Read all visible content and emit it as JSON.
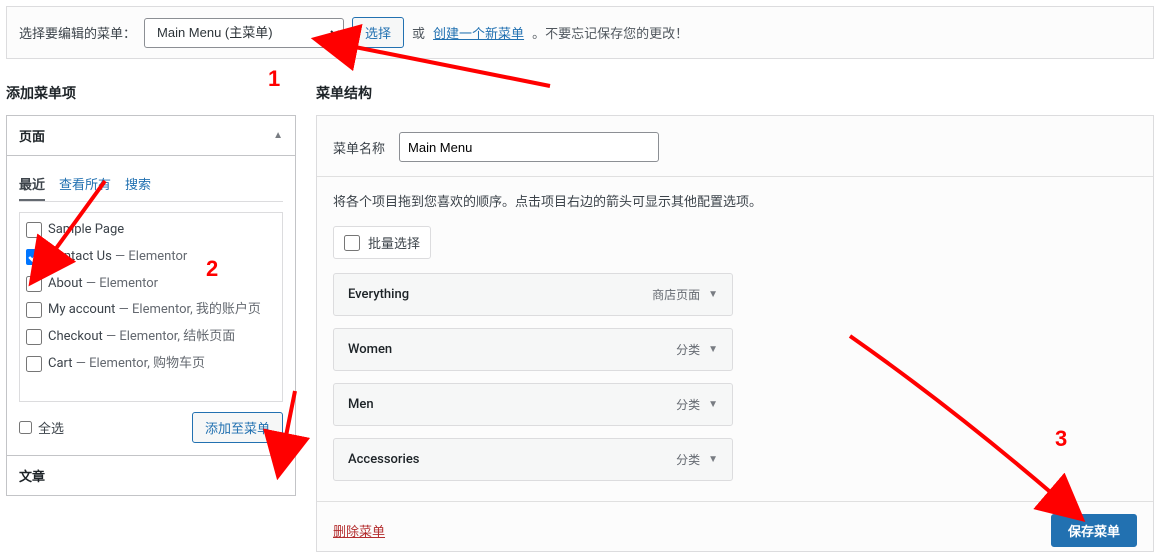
{
  "topbar": {
    "label": "选择要编辑的菜单：",
    "selected_menu": "Main Menu (主菜单)",
    "select_button": "选择",
    "or_text": "或",
    "create_link": "创建一个新菜单",
    "reminder": "。不要忘记保存您的更改！"
  },
  "left": {
    "heading": "添加菜单项",
    "pages_box_title": "页面",
    "tabs": {
      "recent": "最近",
      "view_all": "查看所有",
      "search": "搜索"
    },
    "pages": [
      {
        "label": "Sample Page",
        "suffix": "",
        "checked": false
      },
      {
        "label": "Contact Us",
        "suffix": " — Elementor",
        "checked": true
      },
      {
        "label": "About",
        "suffix": " — Elementor",
        "checked": false
      },
      {
        "label": "My account",
        "suffix": " — Elementor, 我的账户页",
        "checked": false
      },
      {
        "label": "Checkout",
        "suffix": " — Elementor, 结帐页面",
        "checked": false
      },
      {
        "label": "Cart",
        "suffix": " — Elementor, 购物车页",
        "checked": false
      }
    ],
    "select_all": "全选",
    "add_to_menu": "添加至菜单",
    "posts_box_title": "文章"
  },
  "right": {
    "heading": "菜单结构",
    "menu_name_label": "菜单名称",
    "menu_name_value": "Main Menu",
    "instructions": "将各个项目拖到您喜欢的顺序。点击项目右边的箭头可显示其他配置选项。",
    "bulk_select": "批量选择",
    "items": [
      {
        "title": "Everything",
        "type": "商店页面"
      },
      {
        "title": "Women",
        "type": "分类"
      },
      {
        "title": "Men",
        "type": "分类"
      },
      {
        "title": "Accessories",
        "type": "分类"
      }
    ],
    "delete_menu": "删除菜单",
    "save_menu": "保存菜单"
  },
  "annotations": {
    "one": "1",
    "two": "2",
    "three": "3"
  }
}
